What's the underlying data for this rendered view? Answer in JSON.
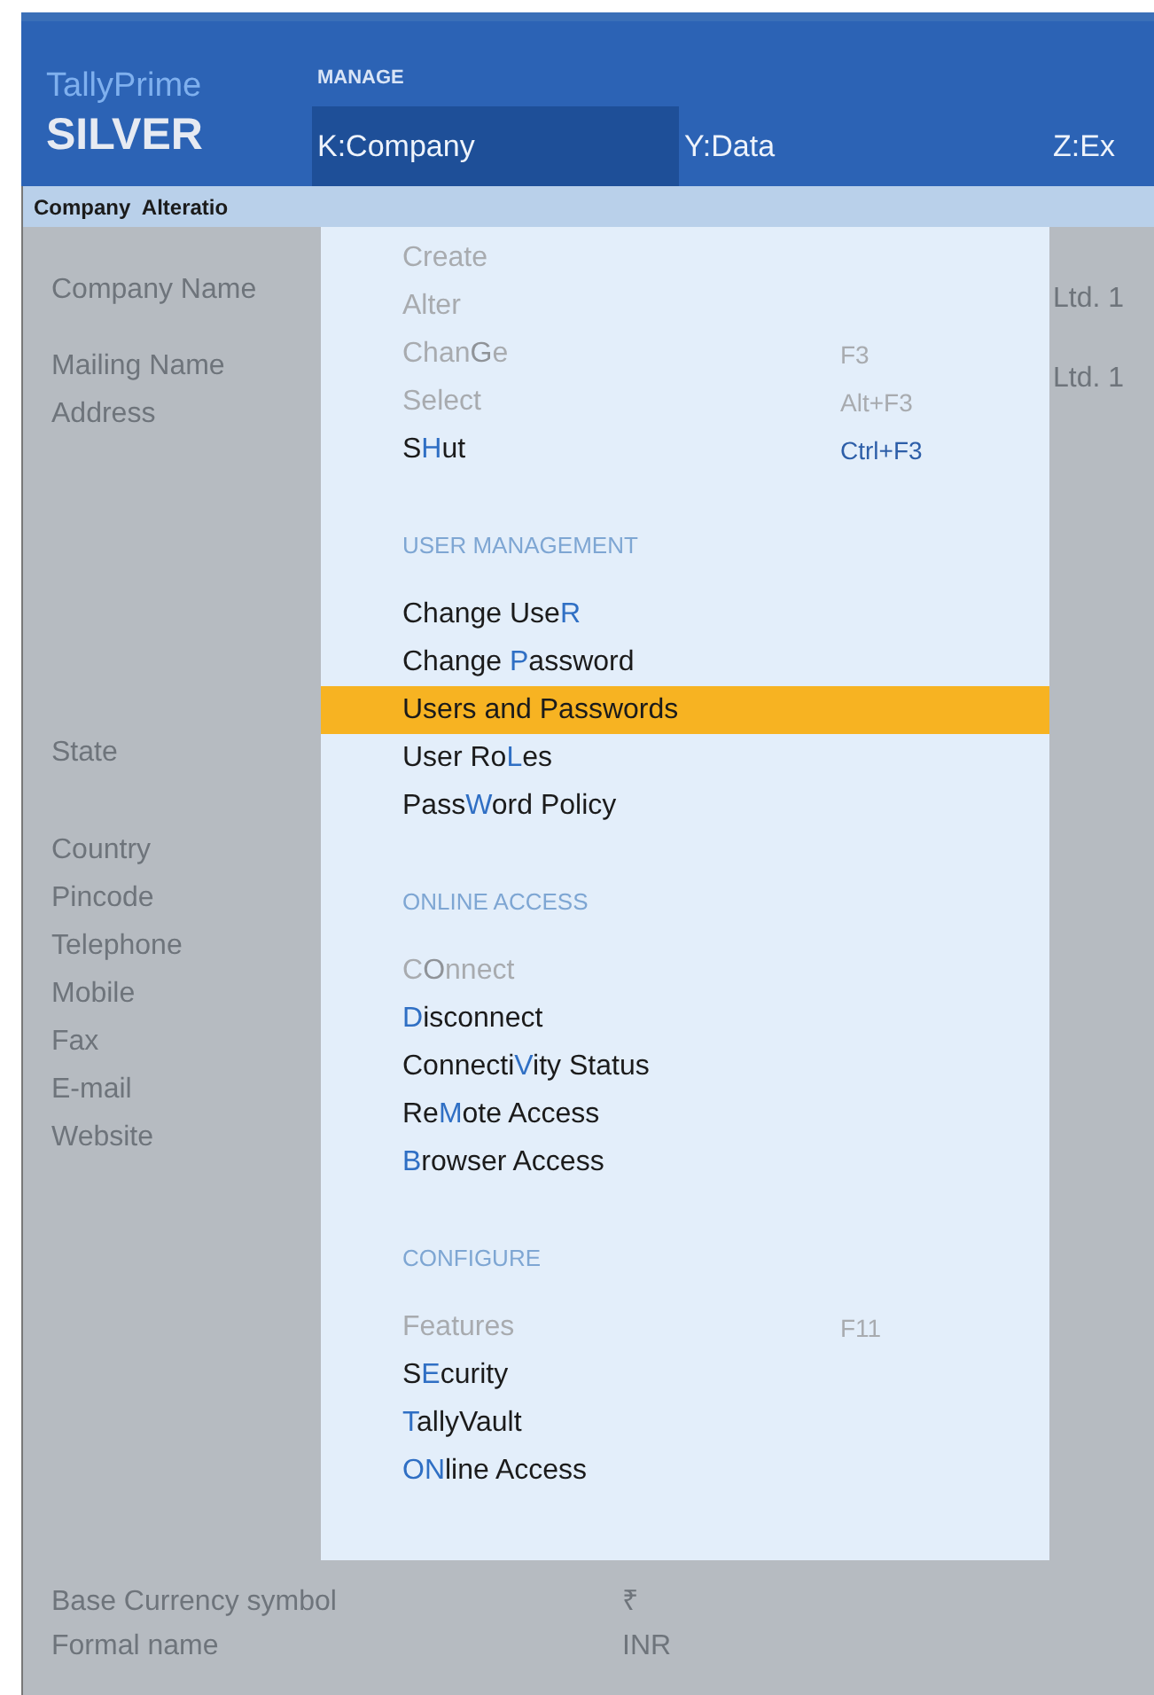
{
  "brand": {
    "product": "TallyPrime",
    "edition": "SILVER"
  },
  "top_menu": {
    "title": "MANAGE",
    "items": [
      {
        "label": "K:Company",
        "selected": true
      },
      {
        "label": "Y:Data",
        "selected": false
      },
      {
        "label": "Z:Ex",
        "selected": false
      }
    ]
  },
  "screen_title": "Company  Alteratio",
  "form": {
    "groups": [
      [
        "Company Name"
      ],
      [
        "Mailing Name",
        "Address"
      ],
      [
        "State"
      ],
      [
        "Country",
        "Pincode",
        "Telephone",
        "Mobile",
        "Fax",
        "E-mail",
        "Website"
      ]
    ],
    "right_values": [
      "Ltd. 1",
      "Ltd. 1"
    ],
    "footer": [
      {
        "label": "Base Currency symbol",
        "value": "₹"
      },
      {
        "label": "Formal name",
        "value": "INR"
      }
    ]
  },
  "menu": {
    "sections": [
      {
        "items": [
          {
            "label": "Create",
            "disabled": true,
            "selected": false
          },
          {
            "label": "Alter",
            "disabled": true,
            "selected": false
          },
          {
            "label": "Chan**G**e",
            "shortcut": "F3",
            "disabled": true,
            "selected": false
          },
          {
            "label": "Select",
            "shortcut": "Alt+F3",
            "disabled": true,
            "selected": false
          },
          {
            "label": "S**H**ut",
            "shortcut": "Ctrl+F3",
            "disabled": false,
            "selected": false
          }
        ]
      },
      {
        "heading": "USER MANAGEMENT",
        "items": [
          {
            "label": "Change Use**R**",
            "disabled": false,
            "selected": false
          },
          {
            "label": "Change **P**assword",
            "disabled": false,
            "selected": false
          },
          {
            "label": "Users and Passwords",
            "disabled": false,
            "selected": true
          },
          {
            "label": "User Ro**L**es",
            "disabled": false,
            "selected": false
          },
          {
            "label": "Pass**W**ord Policy",
            "disabled": false,
            "selected": false
          }
        ]
      },
      {
        "heading": "ONLINE ACCESS",
        "items": [
          {
            "label": "C**O**nnect",
            "disabled": true,
            "selected": false
          },
          {
            "label": "**D**isconnect",
            "disabled": false,
            "selected": false
          },
          {
            "label": "Connecti**V**ity Status",
            "disabled": false,
            "selected": false
          },
          {
            "label": "Re**M**ote Access",
            "disabled": false,
            "selected": false
          },
          {
            "label": "**B**rowser Access",
            "disabled": false,
            "selected": false
          }
        ]
      },
      {
        "heading": "CONFIGURE",
        "items": [
          {
            "label": "Features",
            "shortcut": "F11",
            "disabled": true,
            "selected": false
          },
          {
            "label": "S**E**curity",
            "disabled": false,
            "selected": false
          },
          {
            "label": "**T**allyVault",
            "disabled": false,
            "selected": false
          },
          {
            "label": "**ON**line Access",
            "disabled": false,
            "selected": false
          }
        ]
      }
    ]
  }
}
